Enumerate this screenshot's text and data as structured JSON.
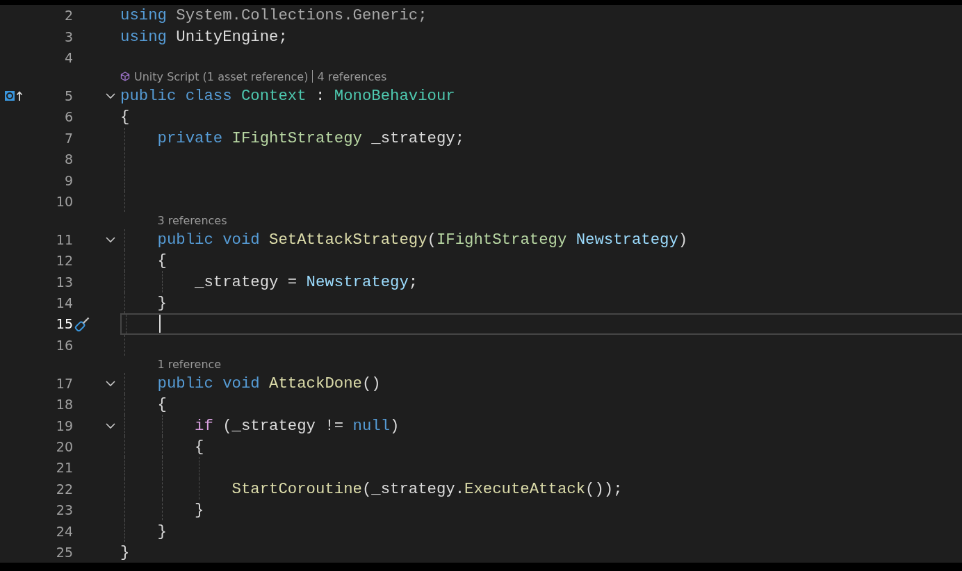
{
  "lines": [
    {
      "number": "2",
      "fold": false,
      "current": false,
      "tokens": [
        {
          "kind": "keyword",
          "text": "using"
        },
        {
          "kind": "dim",
          "text": " System.Collections.Generic;"
        }
      ]
    },
    {
      "number": "3",
      "fold": false,
      "current": false,
      "tokens": [
        {
          "kind": "keyword",
          "text": "using"
        },
        {
          "kind": "plain",
          "text": " UnityEngine;"
        }
      ]
    },
    {
      "number": "4",
      "fold": false,
      "current": false
    },
    {
      "number": "5",
      "fold": true,
      "current": false,
      "margin_icon": {
        "kind": "implements"
      },
      "lens": [
        {
          "kind": "asset",
          "text": "Unity Script (1 asset reference)"
        },
        {
          "kind": "refs",
          "text": "4 references"
        }
      ],
      "tokens": [
        {
          "kind": "keyword",
          "text": "public "
        },
        {
          "kind": "keyword",
          "text": "class "
        },
        {
          "kind": "type",
          "text": "Context"
        },
        {
          "kind": "plain",
          "text": " : "
        },
        {
          "kind": "type",
          "text": "MonoBehaviour"
        }
      ]
    },
    {
      "number": "6",
      "fold": false,
      "current": false,
      "tokens": [
        {
          "kind": "plain",
          "text": "{"
        }
      ],
      "children": [
        {
          "number": "7",
          "fold": false,
          "current": false,
          "tokens": [
            {
              "kind": "keyword",
              "text": "private "
            },
            {
              "kind": "interface",
              "text": "IFightStrategy"
            },
            {
              "kind": "plain",
              "text": " _strategy;"
            }
          ]
        },
        {
          "number": "8",
          "fold": false,
          "current": false
        },
        {
          "number": "9",
          "fold": false,
          "current": false
        },
        {
          "number": "10",
          "fold": false,
          "current": false
        },
        {
          "number": "11",
          "fold": true,
          "current": false,
          "lens": [
            {
              "kind": "refs",
              "text": "3 references"
            }
          ],
          "tokens": [
            {
              "kind": "keyword",
              "text": "public "
            },
            {
              "kind": "keyword",
              "text": "void "
            },
            {
              "kind": "method",
              "text": "SetAttackStrategy"
            },
            {
              "kind": "plain",
              "text": "("
            },
            {
              "kind": "interface",
              "text": "IFightStrategy"
            },
            {
              "kind": "param",
              "text": " Newstrategy"
            },
            {
              "kind": "plain",
              "text": ")"
            }
          ]
        },
        {
          "number": "12",
          "fold": false,
          "current": false,
          "tokens": [
            {
              "kind": "plain",
              "text": "{"
            }
          ],
          "children": [
            {
              "number": "13",
              "fold": false,
              "current": false,
              "tokens": [
                {
                  "kind": "plain",
                  "text": "_strategy = "
                },
                {
                  "kind": "param",
                  "text": "Newstrategy"
                },
                {
                  "kind": "plain",
                  "text": ";"
                }
              ]
            }
          ]
        },
        {
          "number": "14",
          "fold": false,
          "current": false,
          "tokens": [
            {
              "kind": "plain",
              "text": "}"
            }
          ]
        },
        {
          "number": "15",
          "fold": false,
          "current": true,
          "margin_icon": {
            "kind": "quick-actions"
          }
        },
        {
          "number": "16",
          "fold": false,
          "current": false
        },
        {
          "number": "17",
          "fold": true,
          "current": false,
          "lens": [
            {
              "kind": "refs",
              "text": "1 reference"
            }
          ],
          "tokens": [
            {
              "kind": "keyword",
              "text": "public "
            },
            {
              "kind": "keyword",
              "text": "void "
            },
            {
              "kind": "method",
              "text": "AttackDone"
            },
            {
              "kind": "plain",
              "text": "()"
            }
          ]
        },
        {
          "number": "18",
          "fold": false,
          "current": false,
          "tokens": [
            {
              "kind": "plain",
              "text": "{"
            }
          ],
          "children": [
            {
              "number": "19",
              "fold": true,
              "current": false,
              "tokens": [
                {
                  "kind": "control",
                  "text": "if"
                },
                {
                  "kind": "plain",
                  "text": " (_strategy != "
                },
                {
                  "kind": "keyword",
                  "text": "null"
                },
                {
                  "kind": "plain",
                  "text": ")"
                }
              ]
            },
            {
              "number": "20",
              "fold": false,
              "current": false,
              "tokens": [
                {
                  "kind": "plain",
                  "text": "{"
                }
              ],
              "children": [
                {
                  "number": "21",
                  "fold": false,
                  "current": false
                },
                {
                  "number": "22",
                  "fold": false,
                  "current": false,
                  "tokens": [
                    {
                      "kind": "method",
                      "text": "StartCoroutine"
                    },
                    {
                      "kind": "plain",
                      "text": "(_strategy."
                    },
                    {
                      "kind": "method",
                      "text": "ExecuteAttack"
                    },
                    {
                      "kind": "plain",
                      "text": "());"
                    }
                  ]
                }
              ]
            },
            {
              "number": "23",
              "fold": false,
              "current": false,
              "tokens": [
                {
                  "kind": "plain",
                  "text": "}"
                }
              ]
            }
          ]
        },
        {
          "number": "24",
          "fold": false,
          "current": false,
          "tokens": [
            {
              "kind": "plain",
              "text": "}"
            }
          ]
        }
      ]
    },
    {
      "number": "25",
      "fold": false,
      "current": false,
      "tokens": [
        {
          "kind": "plain",
          "text": "}"
        }
      ]
    }
  ]
}
